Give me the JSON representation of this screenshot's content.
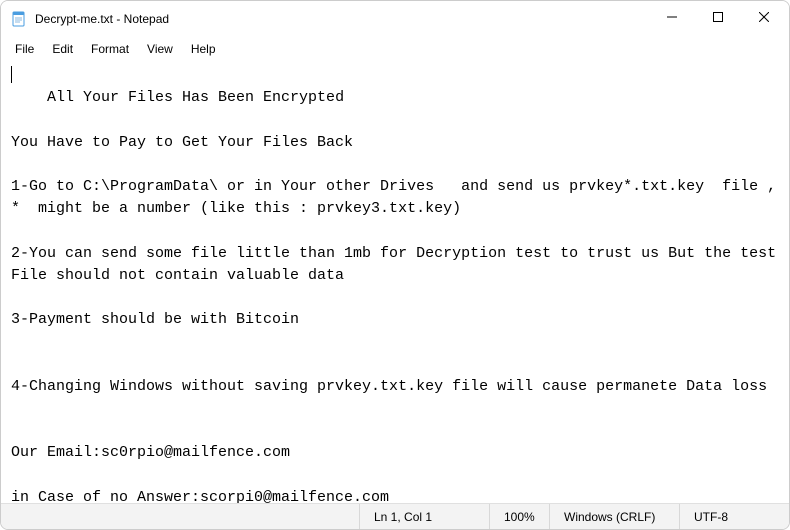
{
  "titlebar": {
    "title": "Decrypt-me.txt - Notepad"
  },
  "menubar": {
    "items": [
      {
        "label": "File"
      },
      {
        "label": "Edit"
      },
      {
        "label": "Format"
      },
      {
        "label": "View"
      },
      {
        "label": "Help"
      }
    ]
  },
  "editor": {
    "content": "All Your Files Has Been Encrypted\n\nYou Have to Pay to Get Your Files Back\n\n1-Go to C:\\ProgramData\\ or in Your other Drives   and send us prvkey*.txt.key  file ,  *  might be a number (like this : prvkey3.txt.key)\n\n2-You can send some file little than 1mb for Decryption test to trust us But the test File should not contain valuable data\n\n3-Payment should be with Bitcoin\n\n\n4-Changing Windows without saving prvkey.txt.key file will cause permanete Data loss\n\n\nOur Email:sc0rpio@mailfence.com\n\nin Case of no Answer:scorpi0@mailfence.com"
  },
  "statusbar": {
    "position": "Ln 1, Col 1",
    "zoom": "100%",
    "lineending": "Windows (CRLF)",
    "encoding": "UTF-8"
  }
}
